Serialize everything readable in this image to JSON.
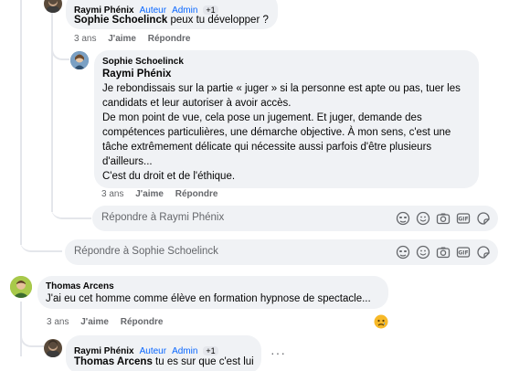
{
  "comments": [
    {
      "author": "Raymi Phénix",
      "badges": [
        "Auteur",
        "Admin"
      ],
      "plus": "+1",
      "mention": "Sophie Schoelinck",
      "text": " peux tu développer ?",
      "time": "3 ans",
      "like": "J'aime",
      "reply": "Répondre"
    },
    {
      "author": "Sophie Schoelinck",
      "mention": "Raymi Phénix",
      "paragraphs": [
        "Je rebondissais sur la partie « juger » si la personne est apte ou pas, tuer les candidats et leur autoriser à avoir accès.",
        "De mon point de vue, cela pose un jugement. Et juger, demande des compétences particulières, une démarche objective. À mon sens, c'est une tâche extrêmement délicate qui nécessite aussi parfois d'être plusieurs d'ailleurs...",
        "C'est du droit et de l'éthique."
      ],
      "time": "3 ans",
      "like": "J'aime",
      "reply": "Répondre"
    },
    {
      "author": "Thomas Arcens",
      "text": "J'ai eu cet homme comme élève en formation hypnose de spectacle...",
      "time": "3 ans",
      "like": "J'aime",
      "reply": "Répondre",
      "reaction": "sad-reaction"
    },
    {
      "author": "Raymi Phénix",
      "badges": [
        "Auteur",
        "Admin"
      ],
      "plus": "+1",
      "mention": "Thomas Arcens",
      "text": " tu es sur que c'est lui",
      "more": "···"
    }
  ],
  "reply_boxes": [
    {
      "placeholder": "Répondre à Raymi Phénix"
    },
    {
      "placeholder": "Répondre à Sophie Schoelinck"
    }
  ],
  "tool_icons": [
    "avatar-sticker-icon",
    "emoji-icon",
    "camera-icon",
    "gif-icon",
    "sticker-icon"
  ],
  "colors": {
    "bubble": "#f0f2f5",
    "accent": "#0866ff",
    "meta": "#65676b"
  }
}
